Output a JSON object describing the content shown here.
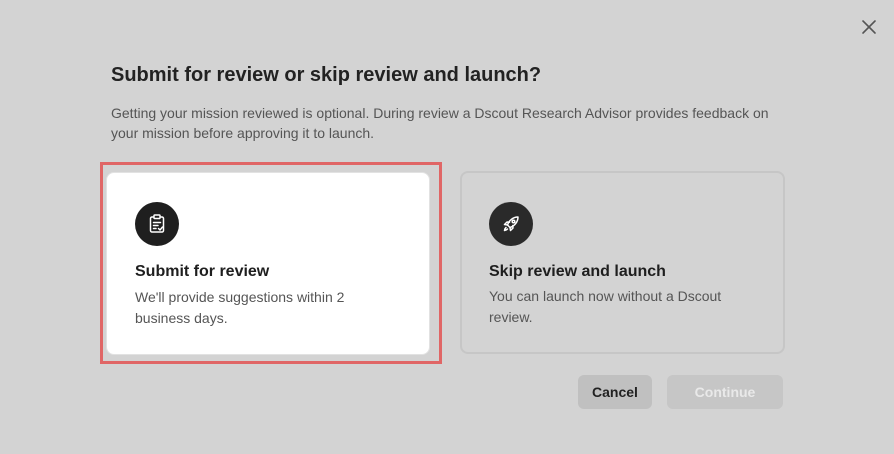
{
  "dialog": {
    "title": "Submit for review or skip review and launch?",
    "description": "Getting your mission reviewed is optional. During review a Dscout Research Advisor provides feedback on your mission before approving it to launch.",
    "close_icon": "close-icon"
  },
  "options": [
    {
      "icon": "clipboard-check-icon",
      "title": "Submit for review",
      "description": "We'll provide suggestions within 2 business days.",
      "selected": true
    },
    {
      "icon": "rocket-icon",
      "title": "Skip review and launch",
      "description": "You can launch now without a Dscout review.",
      "selected": false
    }
  ],
  "actions": {
    "cancel_label": "Cancel",
    "continue_label": "Continue",
    "continue_disabled": true
  },
  "colors": {
    "overlay_background": "#d3d3d3",
    "selected_card": "#ffffff",
    "selection_outline": "#e06666",
    "icon_circle": "#1f1f1f",
    "disabled_button_text": "#e9e9e9"
  }
}
